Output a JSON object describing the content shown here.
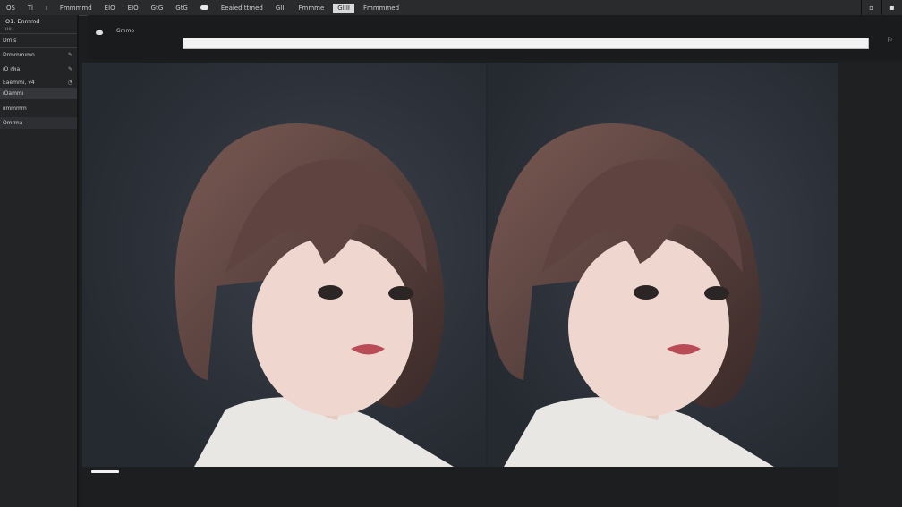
{
  "menubar": {
    "items": [
      {
        "label": "OS"
      },
      {
        "label": "Ti"
      },
      {
        "label": "ı"
      },
      {
        "label": "Fmmmmd"
      },
      {
        "label": "EIO"
      },
      {
        "label": "EIO"
      },
      {
        "label": "GtG"
      },
      {
        "label": "GtG"
      },
      {
        "label": "Eeaied ttmed"
      },
      {
        "label": "GIII"
      },
      {
        "label": "Fmmme"
      },
      {
        "label": "GIIII"
      },
      {
        "label": "Fmmmmed"
      }
    ],
    "active_index": 11,
    "window_icons": [
      "minimize-icon",
      "close-icon"
    ]
  },
  "sidebar": {
    "title": "O1. Enmmd",
    "subtitle": "ıııı",
    "items": [
      {
        "label": "Dmıs",
        "end": ""
      },
      {
        "label": "Drmmmımn",
        "end": "✎"
      },
      {
        "label": "ıO ı9ıa",
        "end": "✎"
      },
      {
        "label": "Eaemmı, v4",
        "end": "◔"
      },
      {
        "label": "ıOammı",
        "end": ""
      },
      {
        "label": "ıımmmm",
        "end": ""
      },
      {
        "label": "Omrma",
        "end": ""
      }
    ]
  },
  "toolbar": {
    "label": "Gmmo",
    "input_value": "",
    "right_icon": "⚐"
  },
  "canvas": {
    "background": "#2a2e36",
    "hair_color": "#5a3f3a",
    "skin_color": "#efd6cf",
    "shirt_color": "#e9e7e4",
    "lip_color": "#b94b57"
  },
  "status": {
    "progress": 1.0
  }
}
